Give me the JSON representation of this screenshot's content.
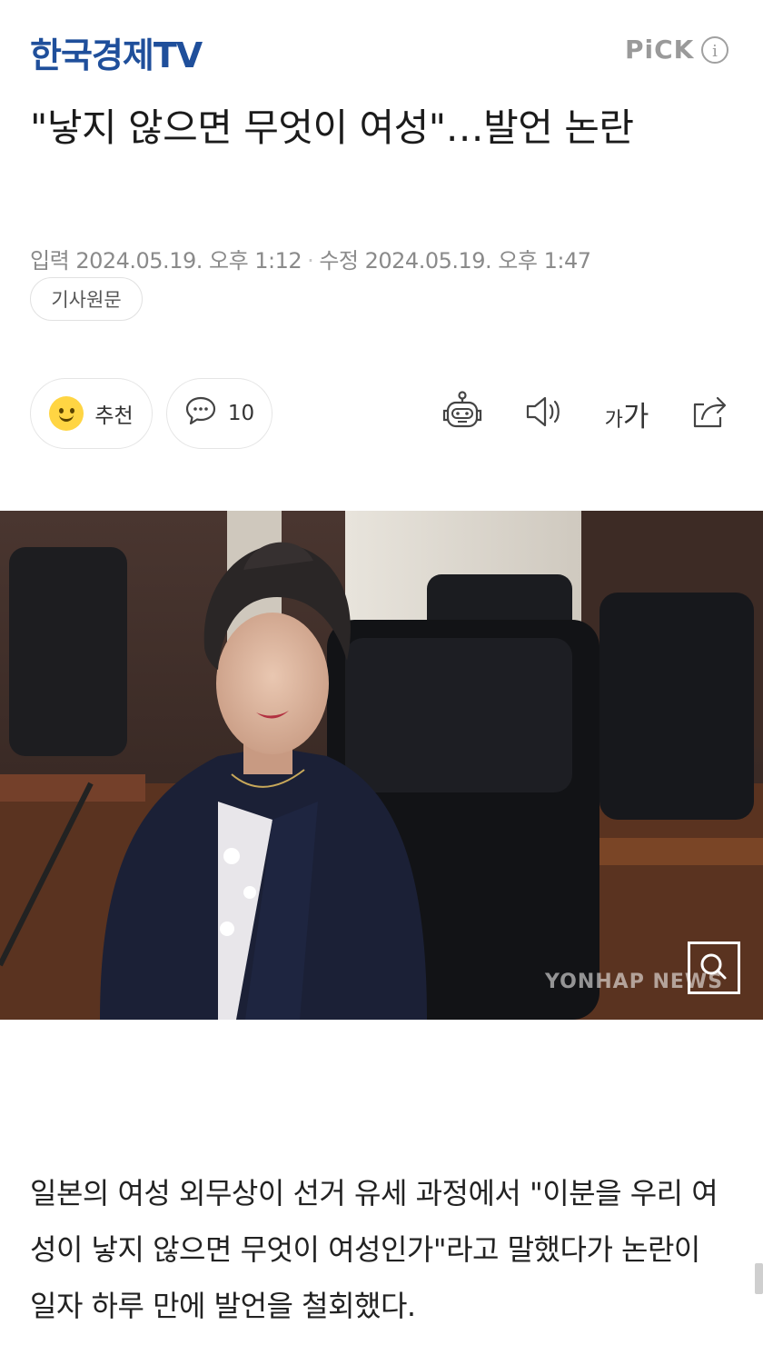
{
  "header": {
    "logo": "한국경제TV",
    "pick_label": "PiCK",
    "pick_info": "i"
  },
  "article": {
    "headline": "\"낳지 않으면 무엇이 여성\"…발언 논란",
    "input_label": "입력",
    "input_time": "2024.05.19. 오후 1:12",
    "separator": "·",
    "modified_label": "수정",
    "modified_time": "2024.05.19. 오후 1:47",
    "original_button": "기사원문",
    "body": "일본의 여성 외무상이 선거 유세 과정에서 \"이분을 우리 여성이 낳지 않으면 무엇이 여성인가\"라고 말했다가 논란이 일자 하루 만에 발언을 철회했다."
  },
  "actions": {
    "recommend_label": "추천",
    "comment_count": "10",
    "font_small": "가",
    "font_large": "가"
  },
  "photo": {
    "watermark": "YONHAP NEWS"
  },
  "icons": [
    "smile-icon",
    "comment-icon",
    "robot-summary-icon",
    "speaker-icon",
    "font-size-icon",
    "share-icon",
    "zoom-icon"
  ],
  "colors": {
    "logo": "#1f4f9b",
    "smile": "#ffd543",
    "meta_text": "#8a8a8a"
  }
}
